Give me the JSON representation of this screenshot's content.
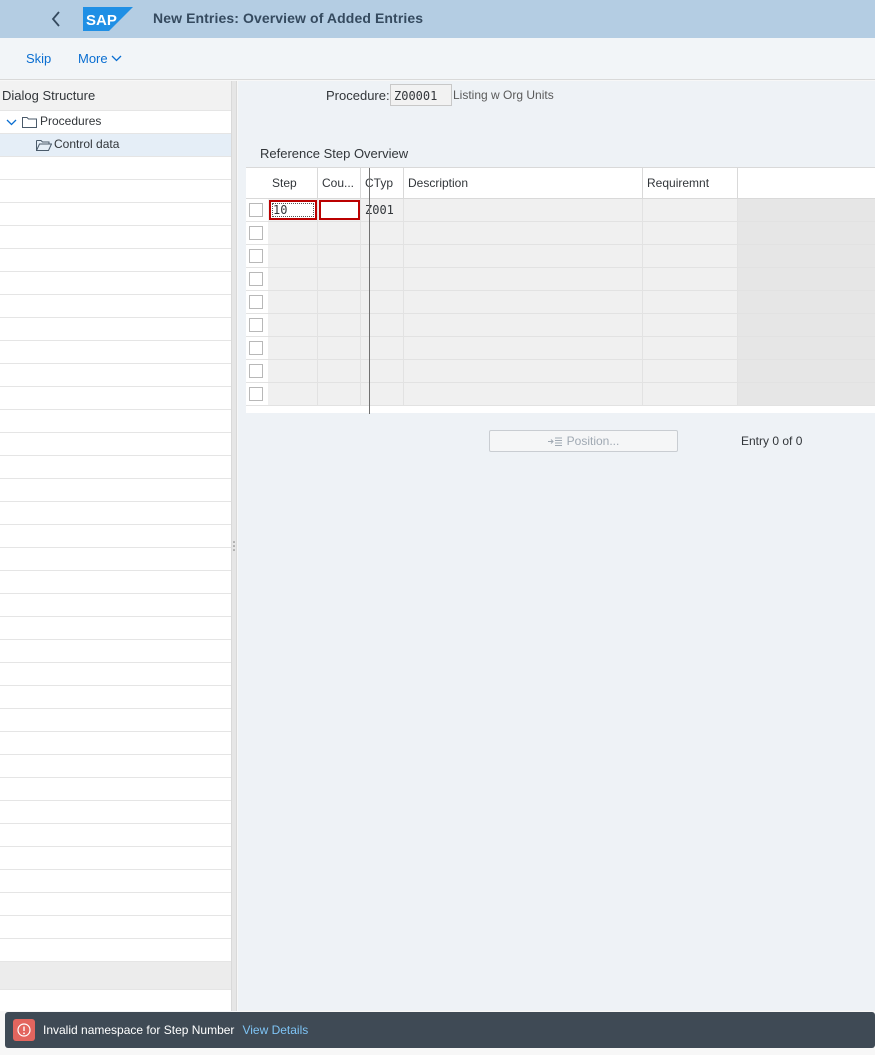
{
  "header": {
    "title": "New Entries: Overview of Added Entries",
    "logo_text": "SAP"
  },
  "toolbar": {
    "skip_label": "Skip",
    "more_label": "More"
  },
  "dialog_structure": {
    "heading": "Dialog Structure",
    "items": [
      {
        "label": "Procedures",
        "icon": "folder-icon",
        "expanded": true
      },
      {
        "label": "Control data",
        "icon": "open-folder-icon",
        "selected": true
      }
    ]
  },
  "procedure": {
    "label": "Procedure:",
    "value": "Z00001",
    "description": "Listing w Org Units"
  },
  "table": {
    "title": "Reference Step Overview",
    "columns": [
      "Step",
      "Cou...",
      "CTyp",
      "Description",
      "Requiremnt"
    ],
    "rows": [
      {
        "step": "10",
        "counter": "",
        "ctyp": "Z001",
        "description": "",
        "requirement": ""
      }
    ]
  },
  "position_button": "Position...",
  "entry_text": "Entry 0 of 0",
  "message": {
    "text": "Invalid namespace for Step Number",
    "link": "View Details",
    "type": "error"
  },
  "colors": {
    "shell": "#b4cde3",
    "accent": "#0a6ed1",
    "error": "#bb0000",
    "message_bar": "#3f4a55"
  }
}
